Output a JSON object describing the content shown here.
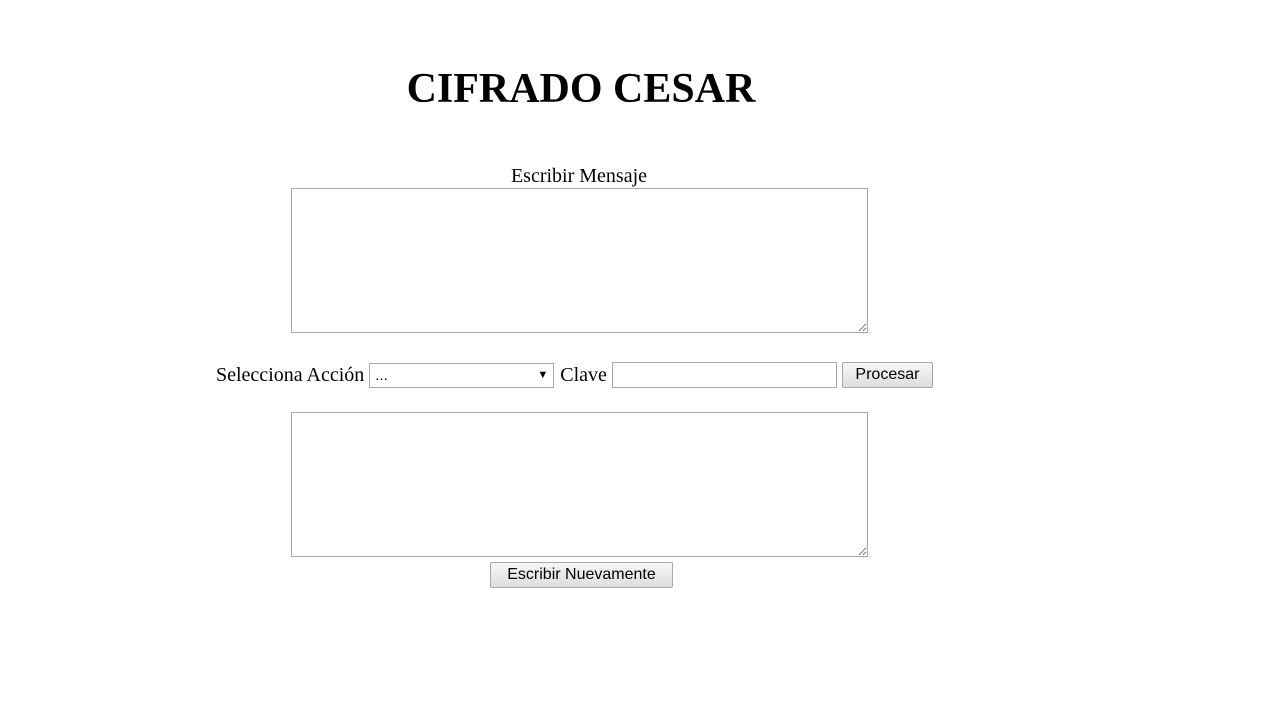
{
  "page": {
    "title": "CIFRADO CESAR"
  },
  "message": {
    "label": "Escribir Mensaje",
    "value": ""
  },
  "action_row": {
    "action_label": "Selecciona Acción",
    "action_selected": "...",
    "key_label": "Clave",
    "key_value": "",
    "process_button": "Procesar"
  },
  "result": {
    "value": ""
  },
  "rewrite_button": "Escribir Nuevamente",
  "icons": {
    "select_arrow": "caret-down-icon",
    "resize_handle": "resize-grip-icon"
  }
}
